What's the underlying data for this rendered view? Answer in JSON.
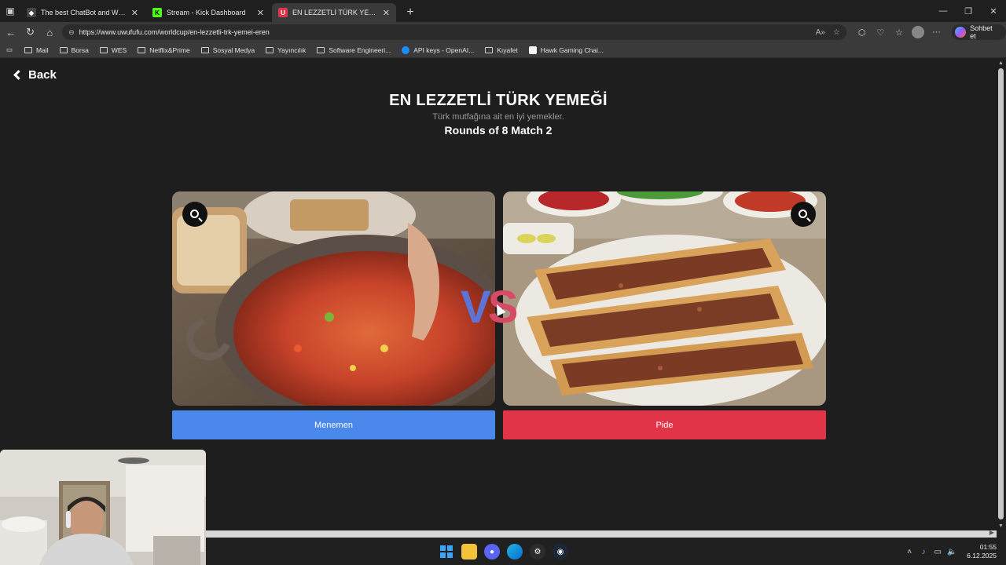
{
  "browser": {
    "tabs": [
      {
        "title": "The best ChatBot and Widgets for",
        "favicon": "chatbot-icon",
        "active": false
      },
      {
        "title": "Stream - Kick Dashboard",
        "favicon": "kick-icon",
        "active": false
      },
      {
        "title": "EN LEZZETLİ TÜRK YEMEĞİ | UwUFUFU",
        "favicon": "uwufufu-icon",
        "active": true
      }
    ],
    "url": "https://www.uwufufu.com/worldcup/en-lezzetli-trk-yemei-eren",
    "chat_button_label": "Sohbet et",
    "bookmarks": [
      "Mail",
      "Borsa",
      "WES",
      "Netflix&Prime",
      "Sosyal Medya",
      "Yayıncılık",
      "Software Engineeri...",
      "API keys - OpenAI...",
      "Kıyafet",
      "Hawk Gaming Chai..."
    ]
  },
  "page": {
    "back_label": "Back",
    "title": "EN LEZZETLİ TÜRK YEMEĞİ",
    "subtitle": "Türk mutfağına ait en iyi yemekler.",
    "round_info": "Rounds of 8 Match 2",
    "vs_label": "VS",
    "options": [
      {
        "name": "Menemen",
        "color": "#4a88ec"
      },
      {
        "name": "Pide",
        "color": "#e23449"
      }
    ]
  },
  "taskbar": {
    "time": "01:55",
    "date": "6.12.2025"
  }
}
